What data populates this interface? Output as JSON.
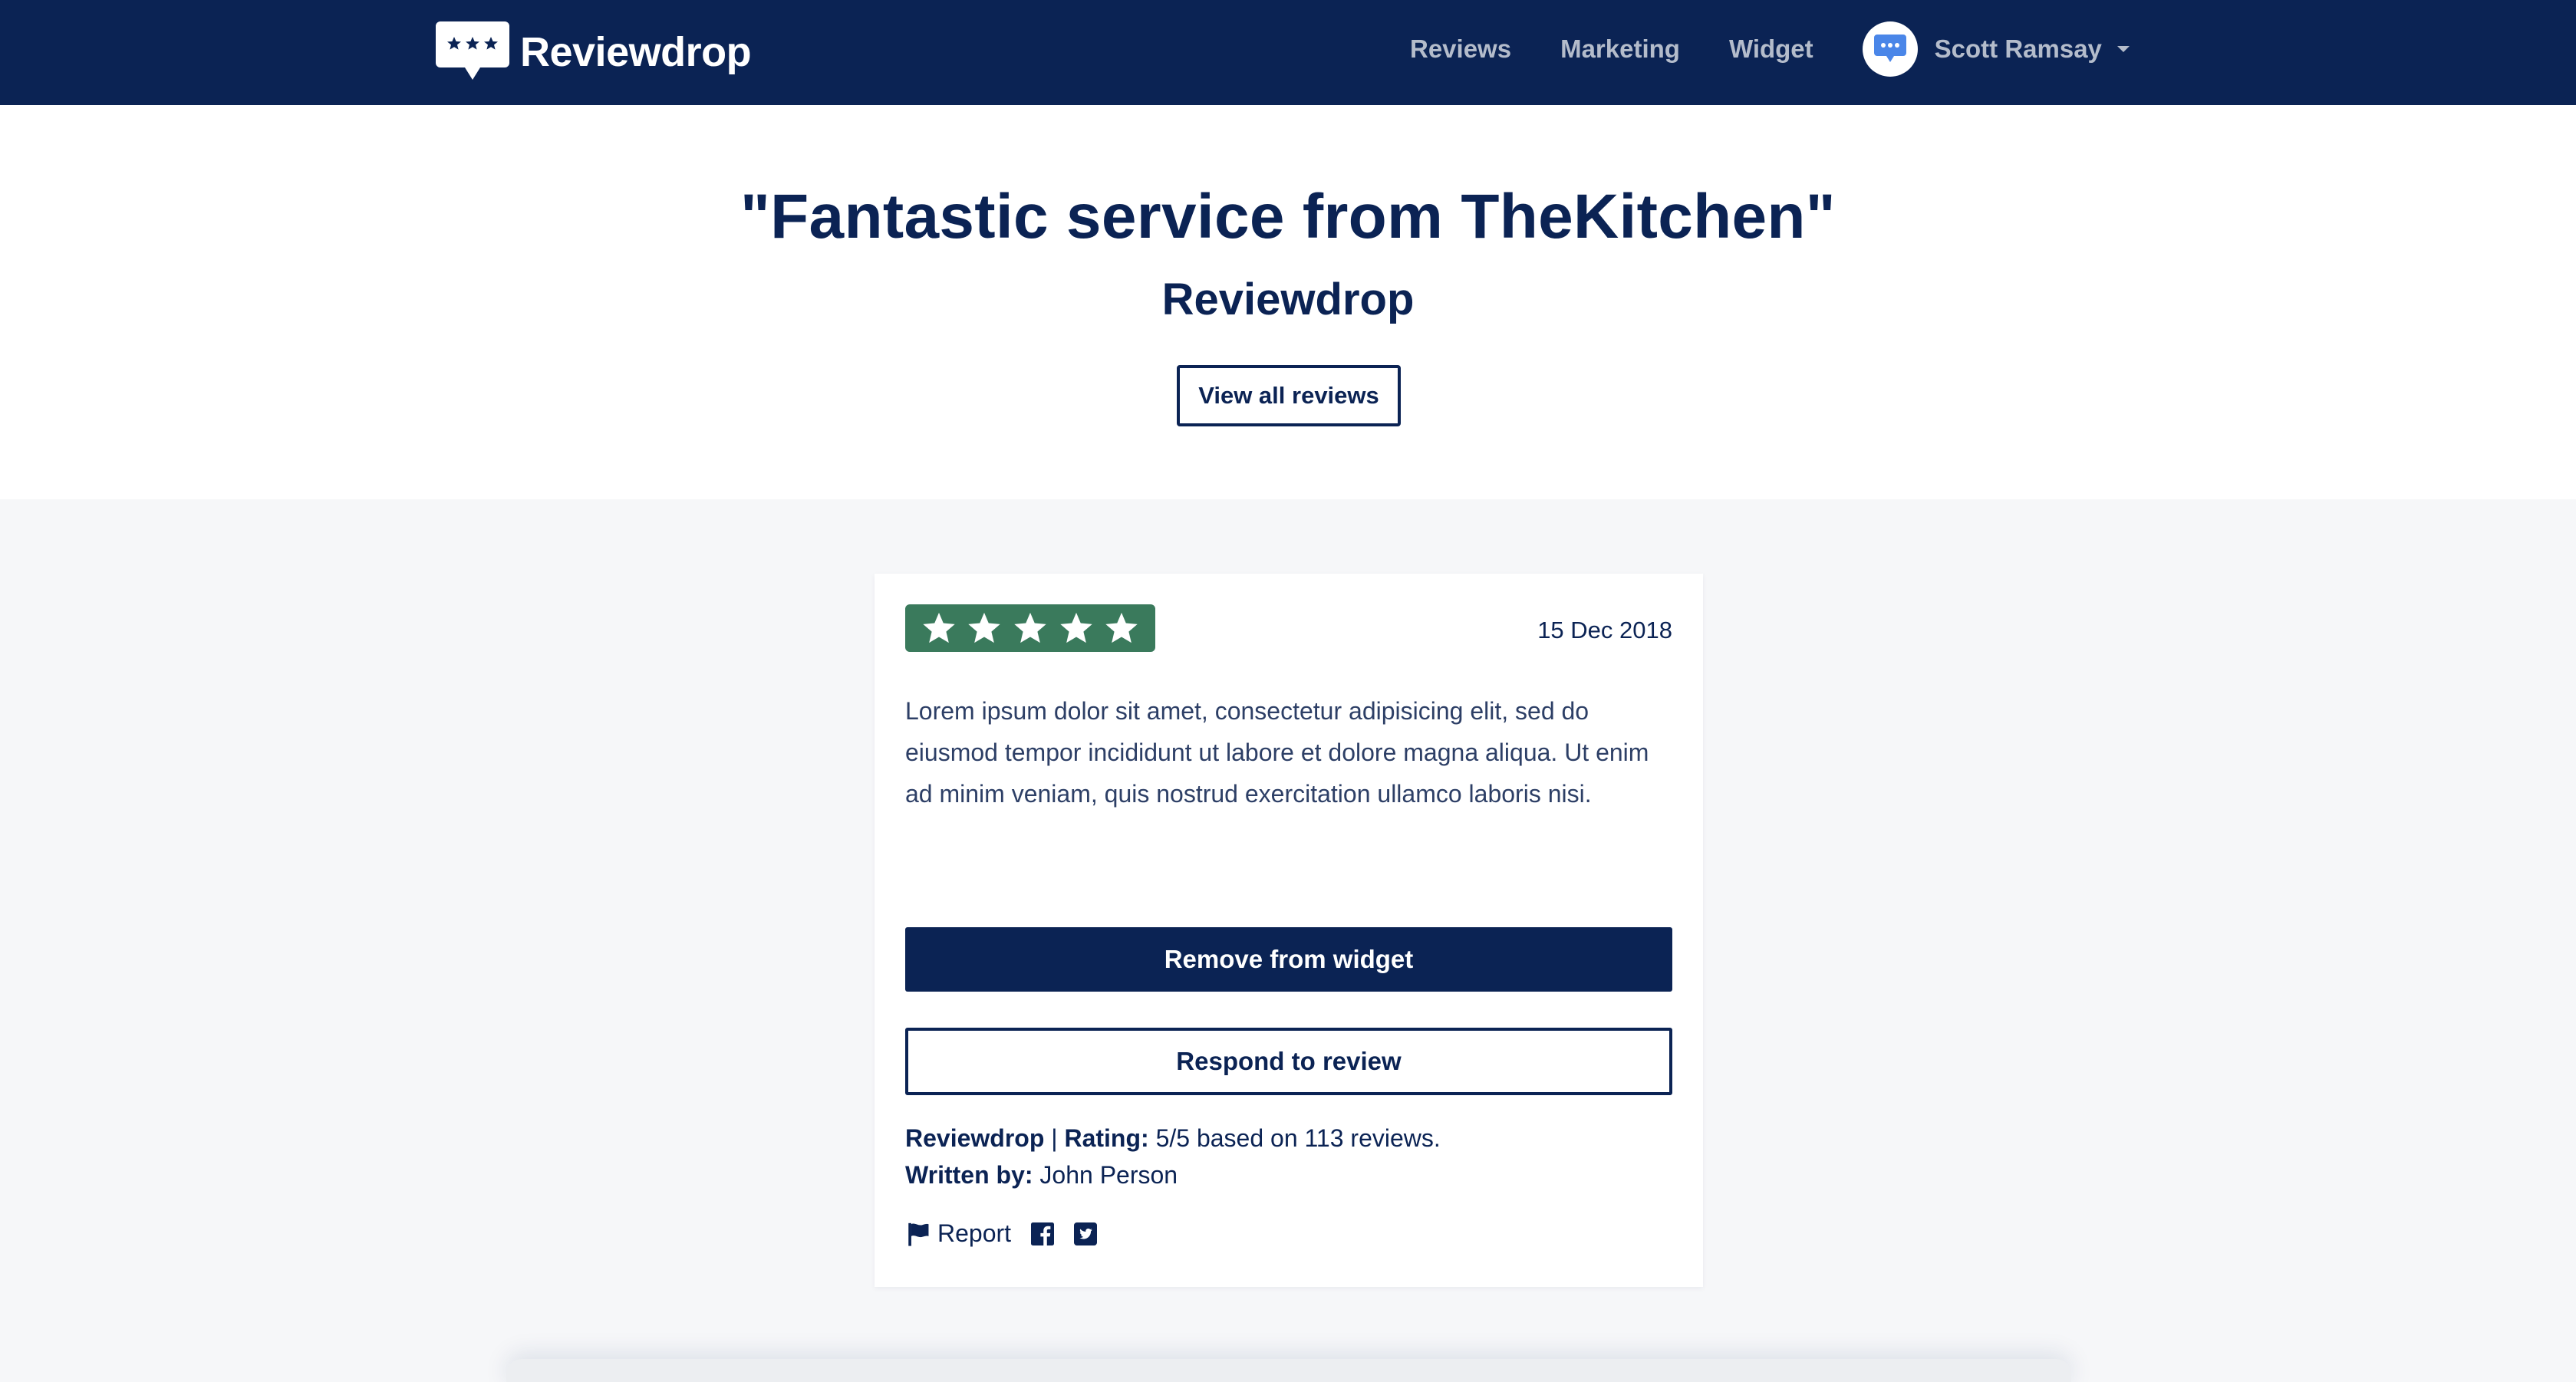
{
  "header": {
    "brand_name": "Reviewdrop",
    "nav": [
      {
        "label": "Reviews"
      },
      {
        "label": "Marketing"
      },
      {
        "label": "Widget"
      }
    ],
    "user": {
      "name": "Scott Ramsay"
    }
  },
  "hero": {
    "title": "\"Fantastic service from TheKitchen\"",
    "subtitle": "Reviewdrop",
    "view_all_label": "View all reviews"
  },
  "review": {
    "rating": 5,
    "rating_max": 5,
    "date": "15 Dec 2018",
    "body": "Lorem ipsum dolor sit amet, consectetur adipisicing elit, sed do eiusmod tempor incididunt ut labore et dolore magna aliqua. Ut enim ad minim veniam, quis nostrud exercitation ullamco laboris nisi.",
    "remove_label": "Remove from widget",
    "respond_label": "Respond to review",
    "business": "Reviewdrop",
    "rating_label": "Rating:",
    "rating_summary": "5/5 based on 113 reviews.",
    "written_by_label": "Written by:",
    "author": "John Person",
    "report_label": "Report"
  },
  "colors": {
    "navy": "#0b2354",
    "rating_green": "#3a7a5c",
    "nav_text": "#b4bccb",
    "page_bg": "#f6f7f9",
    "avatar_icon": "#4a86e8"
  },
  "icons": [
    "logo-chat-stars-icon",
    "chat-bubble-icon",
    "caret-down-icon",
    "star-icon",
    "flag-icon",
    "facebook-icon",
    "twitter-icon"
  ]
}
